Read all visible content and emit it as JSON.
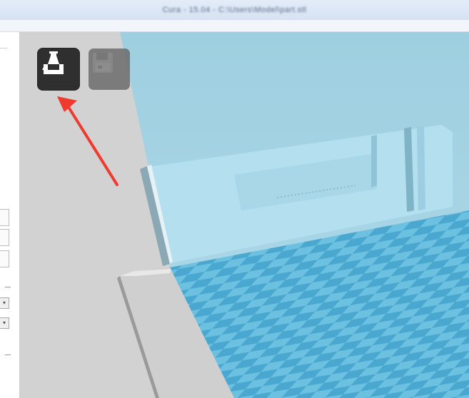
{
  "window": {
    "title": "Cura - 15.04 - C:\\Users\\Model\\part.stl"
  },
  "toolbar": {
    "load_tooltip": "Load",
    "save_tooltip": "Save toolpath"
  },
  "colors": {
    "viewport_background": "#d2d2d2",
    "platform_tile_dark": "#4aa8d0",
    "platform_tile_light": "#6cc0e0",
    "machine_glass": "#a9d9ea",
    "load_button": "#2f2f2f",
    "save_button_disabled": "#5f5f5f",
    "annotation_arrow": "#f03a2e"
  },
  "icons": {
    "load": "load-model-icon",
    "save": "save-gcode-icon",
    "annotation": "red-arrow"
  }
}
